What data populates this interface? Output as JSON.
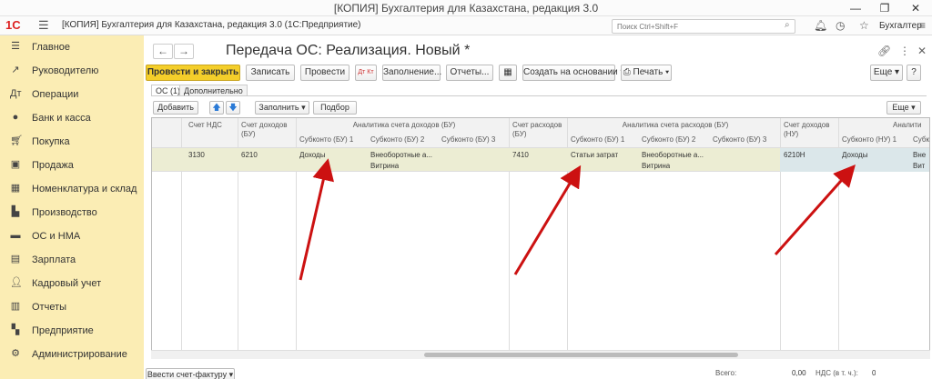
{
  "window": {
    "title": "[КОПИЯ] Бухгалтерия для Казахстана, редакция 3.0",
    "minimize": "—",
    "maximize": "❐",
    "close": "✕"
  },
  "appbar": {
    "logo": "1С",
    "title": "[КОПИЯ] Бухгалтерия для Казахстана, редакция 3.0  (1С:Предприятие)",
    "search_placeholder": "Поиск Ctrl+Shift+F",
    "user": "Бухгалтер"
  },
  "sidebar": {
    "items": [
      {
        "label": "Главное",
        "icon": "menu-icon"
      },
      {
        "label": "Руководителю",
        "icon": "chart-icon"
      },
      {
        "label": "Операции",
        "icon": "operations-icon"
      },
      {
        "label": "Банк и касса",
        "icon": "bank-icon"
      },
      {
        "label": "Покупка",
        "icon": "cart-icon"
      },
      {
        "label": "Продажа",
        "icon": "bag-icon"
      },
      {
        "label": "Номенклатура и склад",
        "icon": "warehouse-icon"
      },
      {
        "label": "Производство",
        "icon": "factory-icon"
      },
      {
        "label": "ОС и НМА",
        "icon": "truck-icon"
      },
      {
        "label": "Зарплата",
        "icon": "salary-icon"
      },
      {
        "label": "Кадровый учет",
        "icon": "people-icon"
      },
      {
        "label": "Отчеты",
        "icon": "reports-icon"
      },
      {
        "label": "Предприятие",
        "icon": "enterprise-icon"
      },
      {
        "label": "Администрирование",
        "icon": "gear-icon"
      }
    ]
  },
  "document": {
    "title": "Передача ОС: Реализация. Новый *",
    "toolbar": {
      "post_close": "Провести и закрыть",
      "save": "Записать",
      "post": "Провести",
      "dtkt": "Дт Кт",
      "fill": "Заполнение...",
      "reports": "Отчеты...",
      "create_based": "Создать на основании",
      "print": "Печать",
      "more": "Еще"
    },
    "tabs": [
      "ОС (1)",
      "Дополнительно"
    ],
    "table_toolbar": {
      "add": "Добавить",
      "fill": "Заполнить",
      "select": "Подбор",
      "more": "Еще"
    },
    "table": {
      "headers": {
        "vat_account": "Счет НДС",
        "income_account_bu": "Счет доходов (БУ)",
        "income_analytics_bu": "Аналитика счета доходов (БУ)",
        "expense_account_bu": "Счет расходов (БУ)",
        "expense_analytics_bu": "Аналитика счета расходов (БУ)",
        "income_account_nu": "Счет доходов (НУ)",
        "income_analytics_nu": "Аналити",
        "sub_bu1": "Субконто (БУ) 1",
        "sub_bu2": "Субконто (БУ) 2",
        "sub_bu3": "Субконто (БУ) 3",
        "sub_nu1": "Субконто (НУ) 1",
        "sub_nu2": "Субк"
      },
      "row": {
        "vat_account": "3130",
        "income_account_bu": "6210",
        "income_sub1": "Доходы",
        "income_sub2": "Внеоборотные а...",
        "income_sub2b": "Витрина",
        "expense_account_bu": "7410",
        "expense_sub1": "Статьи затрат",
        "expense_sub2": "Внеоборотные а...",
        "expense_sub2b": "Витрина",
        "income_account_nu": "6210Н",
        "nu_sub1": "Доходы",
        "nu_sub2": "Вне",
        "nu_sub2b": "Вит"
      }
    },
    "bottom": {
      "invoice_button": "Ввести счет-фактуру",
      "total_label": "Всего:",
      "total_value": "0,00",
      "vat_label": "НДС (в т. ч.):",
      "vat_value": "0"
    }
  },
  "colors": {
    "sidebar_bg": "#fbedb4",
    "primary_button": "#f4ce2a",
    "row_highlight": "#ecedd3",
    "arrow": "#cc1111"
  }
}
